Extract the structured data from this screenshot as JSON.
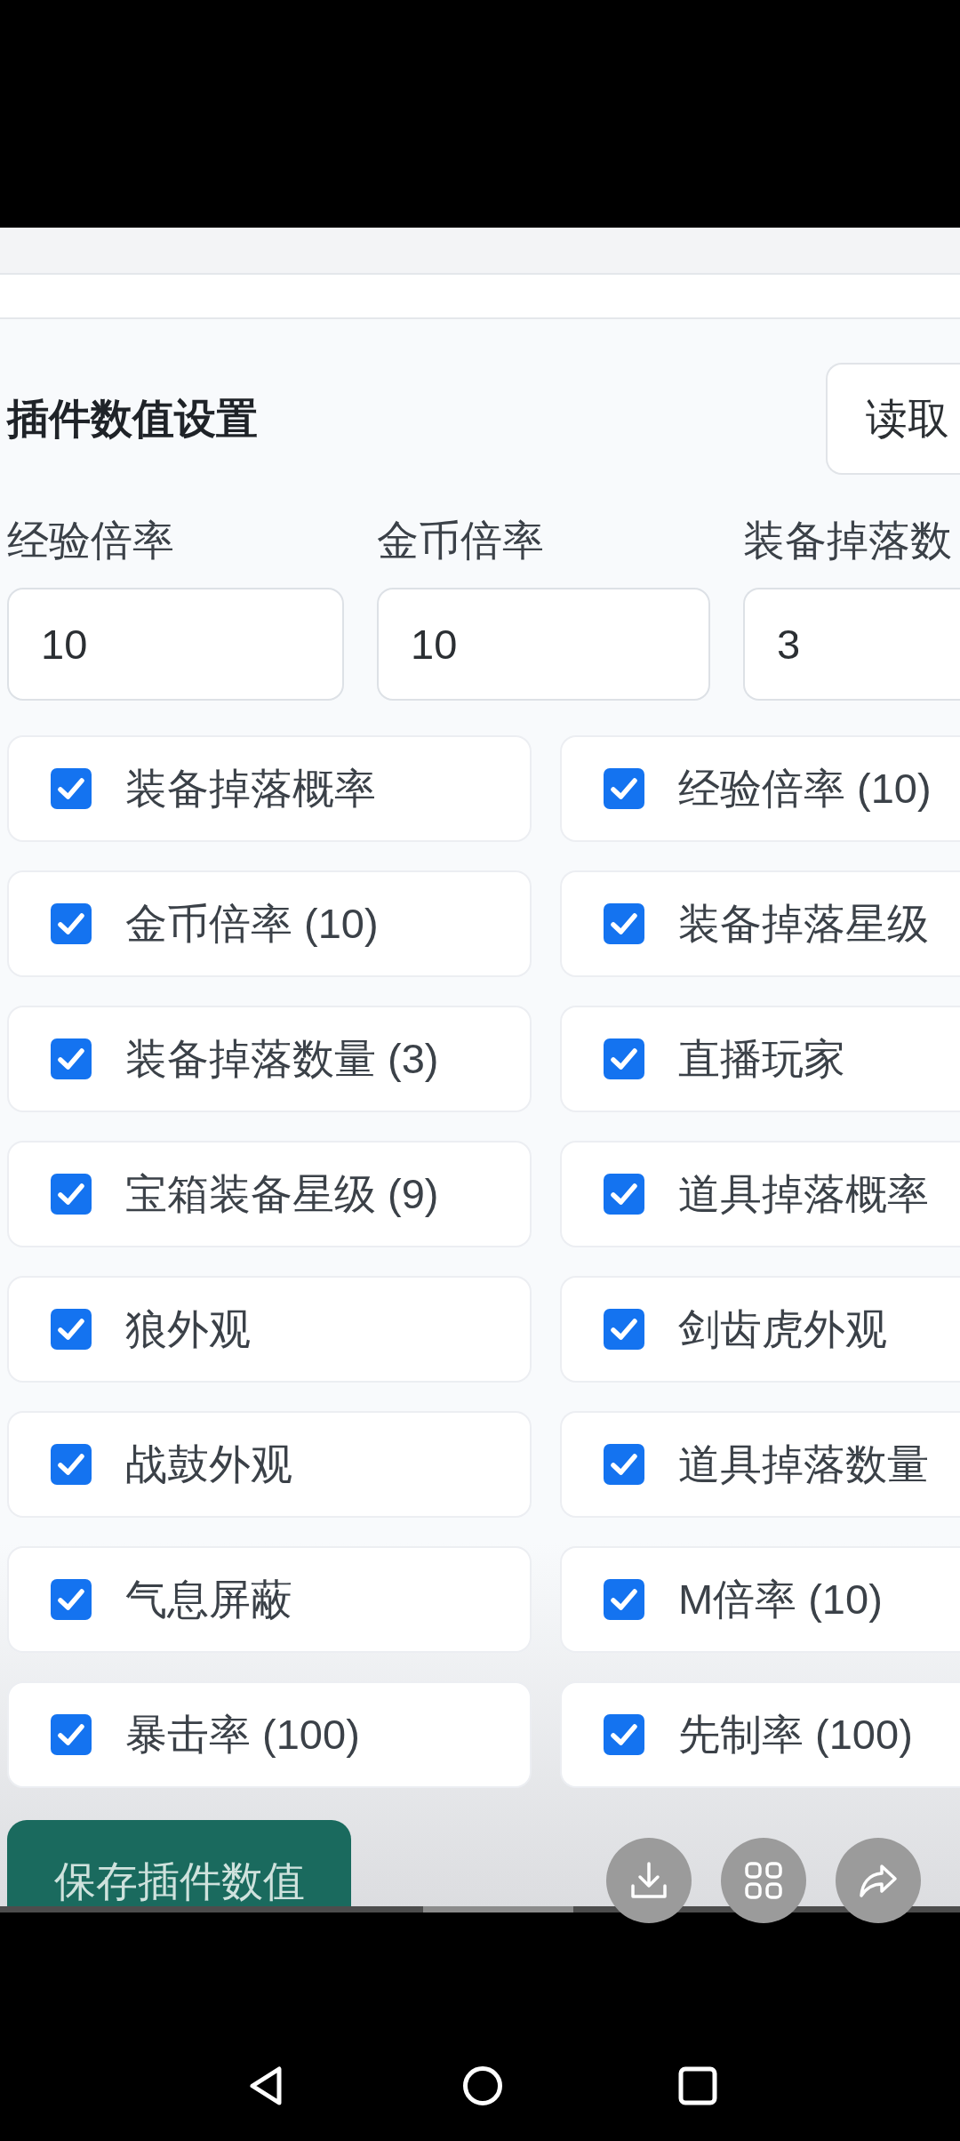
{
  "header": {
    "title": "插件数值设置",
    "read_button": "读取"
  },
  "fields": [
    {
      "label": "经验倍率",
      "value": "10"
    },
    {
      "label": "金币倍率",
      "value": "10"
    },
    {
      "label": "装备掉落数",
      "value": "3"
    }
  ],
  "options": [
    {
      "label": "装备掉落概率",
      "checked": true
    },
    {
      "label": "经验倍率 (10)",
      "checked": true
    },
    {
      "label": "金币倍率 (10)",
      "checked": true
    },
    {
      "label": "装备掉落星级",
      "checked": true
    },
    {
      "label": "装备掉落数量 (3)",
      "checked": true
    },
    {
      "label": "直播玩家",
      "checked": true
    },
    {
      "label": "宝箱装备星级 (9)",
      "checked": true
    },
    {
      "label": "道具掉落概率",
      "checked": true
    },
    {
      "label": "狼外观",
      "checked": true
    },
    {
      "label": "剑齿虎外观",
      "checked": true
    },
    {
      "label": "战鼓外观",
      "checked": true
    },
    {
      "label": "道具掉落数量",
      "checked": true
    },
    {
      "label": "气息屏蔽",
      "checked": true
    },
    {
      "label": "M倍率 (10)",
      "checked": true
    },
    {
      "label": "暴击率 (100)",
      "checked": true
    },
    {
      "label": "先制率 (100)",
      "checked": true
    }
  ],
  "save_button": "保存插件数值"
}
